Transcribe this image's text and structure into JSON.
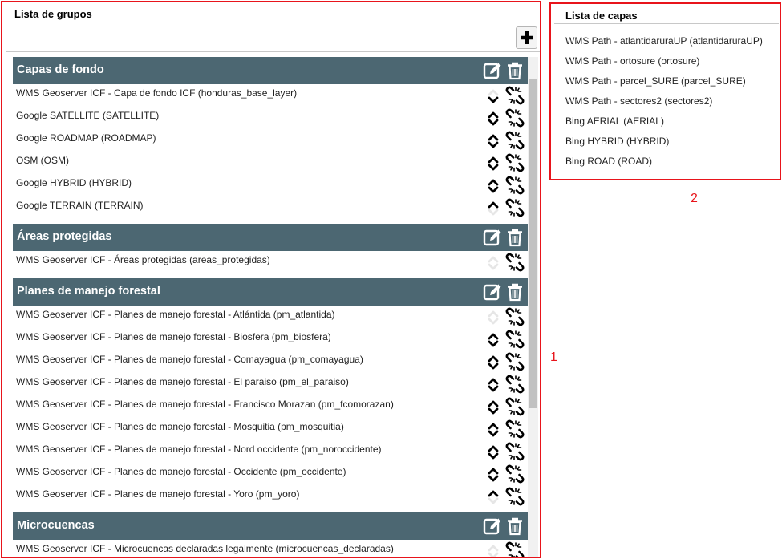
{
  "groups_panel": {
    "title": "Lista de grupos",
    "add_icon": "plus-icon",
    "annotation": "1",
    "groups": [
      {
        "name": "Capas de fondo",
        "layers": [
          {
            "label": "WMS Geoserver ICF - Capa de fondo ICF (honduras_base_layer)",
            "up": false,
            "down": true
          },
          {
            "label": "Google SATELLITE (SATELLITE)",
            "up": true,
            "down": true
          },
          {
            "label": "Google ROADMAP (ROADMAP)",
            "up": true,
            "down": true
          },
          {
            "label": "OSM (OSM)",
            "up": true,
            "down": true
          },
          {
            "label": "Google HYBRID (HYBRID)",
            "up": true,
            "down": true
          },
          {
            "label": "Google TERRAIN (TERRAIN)",
            "up": true,
            "down": false
          }
        ]
      },
      {
        "name": "Áreas protegidas",
        "layers": [
          {
            "label": "WMS Geoserver ICF - Áreas protegidas (areas_protegidas)",
            "up": false,
            "down": false
          }
        ]
      },
      {
        "name": "Planes de manejo forestal",
        "layers": [
          {
            "label": "WMS Geoserver ICF - Planes de manejo forestal - Atlántida (pm_atlantida)",
            "up": false,
            "down": false
          },
          {
            "label": "WMS Geoserver ICF - Planes de manejo forestal - Biosfera (pm_biosfera)",
            "up": true,
            "down": true
          },
          {
            "label": "WMS Geoserver ICF - Planes de manejo forestal - Comayagua (pm_comayagua)",
            "up": true,
            "down": true
          },
          {
            "label": "WMS Geoserver ICF - Planes de manejo forestal - El paraiso (pm_el_paraiso)",
            "up": true,
            "down": true
          },
          {
            "label": "WMS Geoserver ICF - Planes de manejo forestal - Francisco Morazan (pm_fcomorazan)",
            "up": true,
            "down": true
          },
          {
            "label": "WMS Geoserver ICF - Planes de manejo forestal - Mosquitia (pm_mosquitia)",
            "up": true,
            "down": true
          },
          {
            "label": "WMS Geoserver ICF - Planes de manejo forestal - Nord occidente (pm_noroccidente)",
            "up": true,
            "down": true
          },
          {
            "label": "WMS Geoserver ICF - Planes de manejo forestal - Occidente (pm_occidente)",
            "up": true,
            "down": true
          },
          {
            "label": "WMS Geoserver ICF - Planes de manejo forestal - Yoro (pm_yoro)",
            "up": true,
            "down": false
          }
        ]
      },
      {
        "name": "Microcuencas",
        "layers": [
          {
            "label": "WMS Geoserver ICF - Microcuencas declaradas legalmente (microcuencas_declaradas)",
            "up": false,
            "down": false
          }
        ]
      }
    ]
  },
  "layers_panel": {
    "title": "Lista de capas",
    "annotation": "2",
    "items": [
      "WMS Path - atlantidaruraUP (atlantidaruraUP)",
      "WMS Path - ortosure (ortosure)",
      "WMS Path - parcel_SURE (parcel_SURE)",
      "WMS Path - sectores2 (sectores2)",
      "Bing AERIAL (AERIAL)",
      "Bing HYBRID (HYBRID)",
      "Bing ROAD (ROAD)"
    ]
  },
  "icons": {
    "edit": "edit-icon",
    "delete": "trash-icon",
    "move_up": "chevron-up-icon",
    "move_down": "chevron-down-icon",
    "remove_layer": "unlink-icon"
  },
  "colors": {
    "group_header_bg": "#4c6772",
    "annotation_frame": "#e8141b"
  }
}
